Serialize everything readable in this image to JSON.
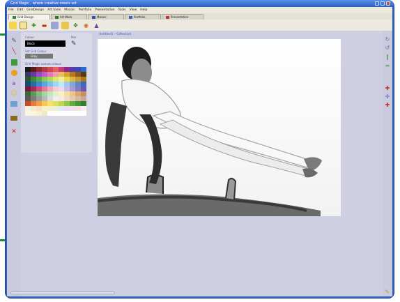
{
  "window": {
    "title": "Grid Magic - where creative meets art"
  },
  "menu": [
    "File",
    "Edit",
    "GridDesign",
    "Art tools",
    "Mosaic",
    "Portfolio",
    "Presentation",
    "Tools",
    "View",
    "Help"
  ],
  "tabs": [
    {
      "label": "Grid Design",
      "color": "#2b8f3c",
      "active": true
    },
    {
      "label": "Art Work",
      "color": "#2a7c2a",
      "active": false
    },
    {
      "label": "Mosaic",
      "color": "#2c52b7",
      "active": false
    },
    {
      "label": "Portfolio",
      "color": "#3b63c9",
      "active": false
    },
    {
      "label": "Presentation",
      "color": "#c8303a",
      "active": false
    }
  ],
  "panel": {
    "colour_label": "Colour",
    "colour_value": "Black",
    "pen_label": "Pen",
    "grid_colour_label": "Set Grid Colour",
    "grid_colour_value": "Grey",
    "palette_label": "Grid Magic named colours"
  },
  "canvas": {
    "label": "Untitled1 - Gifted.bd"
  },
  "colors": {
    "frame": "#2f64c4",
    "client": "#cfcfe3",
    "accent": "#1b8a3a"
  },
  "icons": {
    "toolbar": [
      "new-icon",
      "open-icon",
      "save-icon",
      "brush-icon",
      "grid-icon",
      "image-icon",
      "move-icon",
      "target-icon",
      "cone-icon"
    ],
    "left_tools": [
      "pencil-icon",
      "line-icon",
      "square-icon",
      "circle-icon",
      "text-icon",
      "smiley-icon",
      "photo-icon",
      "frame-icon",
      "delete-icon"
    ],
    "right_tools": [
      "rotate-right-icon",
      "rotate-left-icon",
      "flip-vertical-icon",
      "flip-horizontal-icon",
      "zoom-in-icon",
      "move-icon",
      "zoom-out-icon"
    ]
  }
}
